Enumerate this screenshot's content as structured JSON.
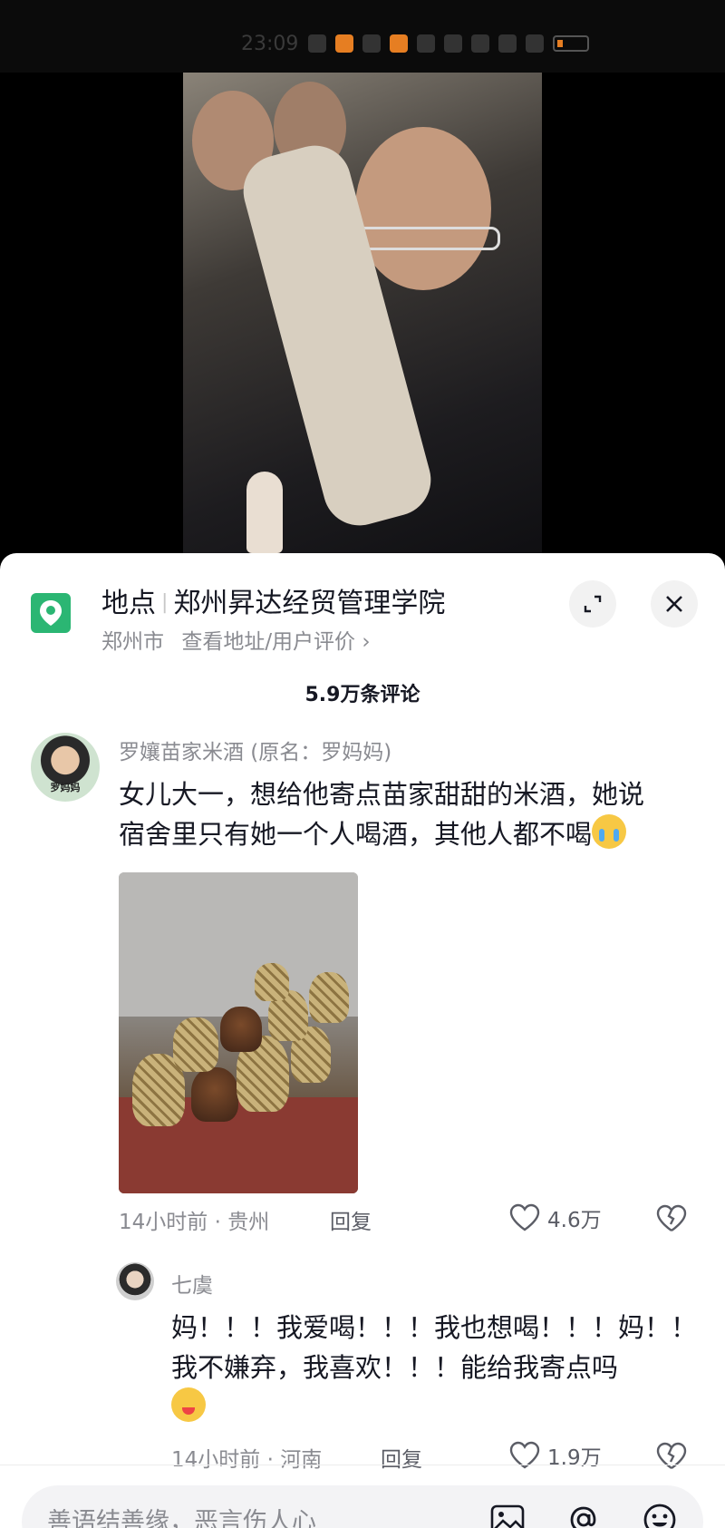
{
  "status_bar": {
    "time": "23:09"
  },
  "location_panel": {
    "label": "地点",
    "name": "郑州昇达经贸管理学院",
    "city": "郑州市",
    "link": "查看地址/用户评价",
    "link_arrow": "›"
  },
  "comments_header": {
    "count": "5.9万条评论"
  },
  "comments": [
    {
      "author": "罗孃苗家米酒 (原名：罗妈妈)",
      "avatar_tag": "罗妈妈",
      "text_line1": "女儿大一，想给他寄点苗家甜甜的米酒，她说",
      "text_line2": "宿舍里只有她一个人喝酒，其他人都不喝",
      "emoji": "crying-face",
      "time_location": "14小时前 · 贵州",
      "reply_label": "回复",
      "likes": "4.6万"
    },
    {
      "author": "七虞",
      "text_line1": "妈！！！我爱喝！！！我也想喝！！！妈！！",
      "text_line2": "我不嫌弃，我喜欢！！！能给我寄点吗",
      "emoji": "winking-tongue-face",
      "time_location": "14小时前 · 河南",
      "reply_label": "回复",
      "likes": "1.9万"
    }
  ],
  "input_bar": {
    "placeholder": "善语结善缘，恶言伤人心"
  },
  "colors": {
    "location_green": "#2bb673",
    "text_primary": "#161823",
    "text_secondary": "#8a8b91"
  }
}
